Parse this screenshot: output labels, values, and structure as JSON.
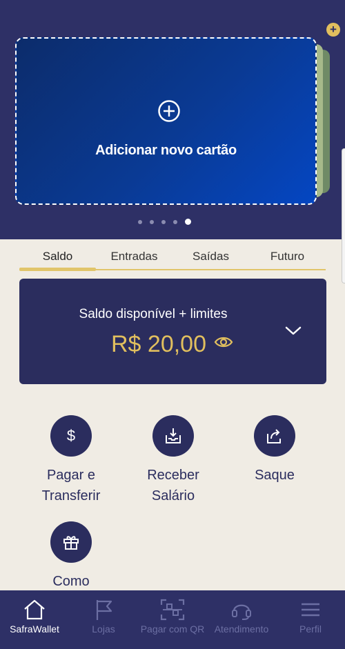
{
  "colors": {
    "top_bg": "#2e3066",
    "accent": "#e1bf5e",
    "card_blue": "#0446c2",
    "page_bg": "#f0ece4"
  },
  "card": {
    "add_label": "Adicionar novo cartão",
    "plus_icon": "plus-circle-icon"
  },
  "carousel": {
    "total": 5,
    "active_index": 4
  },
  "add_badge": {
    "icon": "plus-icon",
    "symbol": "+"
  },
  "tabs": [
    {
      "label": "Saldo",
      "active": true
    },
    {
      "label": "Entradas",
      "active": false
    },
    {
      "label": "Saídas",
      "active": false
    },
    {
      "label": "Futuro",
      "active": false
    }
  ],
  "balance": {
    "label": "Saldo disponível + limites",
    "value": "R$ 20,00",
    "eye_icon": "eye-icon",
    "expand_icon": "chevron-down-icon"
  },
  "actions": [
    {
      "label": "Pagar e Transferir",
      "icon": "dollar-icon"
    },
    {
      "label": "Receber Salário",
      "icon": "inbox-download-icon"
    },
    {
      "label": "Saque",
      "icon": "share-out-icon"
    },
    {
      "label": "Como",
      "icon": "gift-icon"
    }
  ],
  "nav": [
    {
      "label": "SafraWallet",
      "icon": "home-icon",
      "active": true
    },
    {
      "label": "Lojas",
      "icon": "flag-icon",
      "active": false
    },
    {
      "label": "Pagar com QR",
      "icon": "qr-scan-icon",
      "active": false
    },
    {
      "label": "Atendimento",
      "icon": "headset-icon",
      "active": false
    },
    {
      "label": "Perfil",
      "icon": "menu-icon",
      "active": false
    }
  ]
}
